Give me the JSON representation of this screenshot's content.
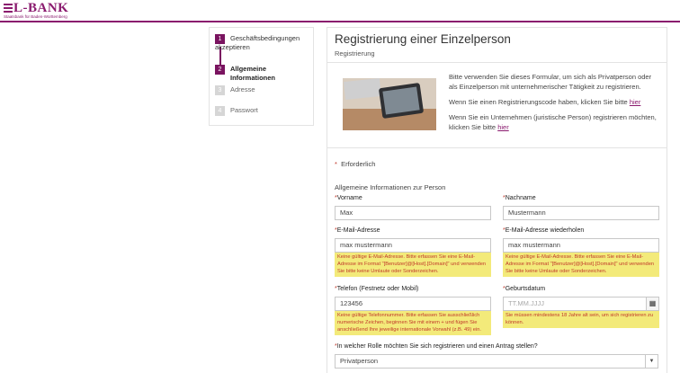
{
  "logo": {
    "name": "L-BANK",
    "subtitle": "Staatsbank für Baden-Württemberg"
  },
  "steps": [
    {
      "num": "1",
      "label": "Geschäftsbedingungen akzeptieren"
    },
    {
      "num": "2",
      "label": "Allgemeine Informationen"
    },
    {
      "num": "3",
      "label": "Adresse"
    },
    {
      "num": "4",
      "label": "Passwort"
    }
  ],
  "main": {
    "title": "Registrierung einer Einzelperson",
    "subtitle": "Registrierung",
    "intro": {
      "p1": "Bitte verwenden Sie dieses Formular, um sich als Privatperson oder als Einzelperson mit unternehmerischer Tätigkeit zu registrieren.",
      "p2_pre": "Wenn Sie einen Registrierungscode haben, klicken Sie bitte ",
      "p3_pre": "Wenn Sie ein Unternehmen (juristische Person) registrieren möchten, klicken Sie bitte ",
      "link": "hier"
    },
    "required_note": "Erforderlich",
    "required_star": "*",
    "group_title": "Allgemeine Informationen zur Person"
  },
  "form": {
    "vorname": {
      "label": "Vorname",
      "value": "Max"
    },
    "nachname": {
      "label": "Nachname",
      "value": "Mustermann"
    },
    "email": {
      "label": "E-Mail-Adresse",
      "value": "max mustermann",
      "error": "Keine gültige E-Mail-Adresse. Bitte erfassen Sie eine E-Mail-Adresse im Format \"[Benutzer]@[Host].[Domain]\" und verwenden Sie bitte keine Umlaute oder Sonderzeichen."
    },
    "email_repeat": {
      "label": "E-Mail-Adresse wiederholen",
      "value": "max mustermann",
      "error": "Keine gültige E-Mail-Adresse. Bitte erfassen Sie eine E-Mail-Adresse im Format \"[Benutzer]@[Host].[Domain]\" und verwenden Sie bitte keine Umlaute oder Sonderzeichen."
    },
    "telefon": {
      "label": "Telefon (Festnetz oder Mobil)",
      "value": "123456",
      "error": "Keine gültige Telefonnummer. Bitte erfassen Sie ausschließlich numerische Zeichen, beginnen Sie mit einem + und fügen Sie anschließend Ihre jeweilige internationale Vorwahl (z.B. 49) ein."
    },
    "geburtsdatum": {
      "label": "Geburtsdatum",
      "placeholder": "TT.MM.JJJJ",
      "error": "Sie müssen mindestens 18 Jahre alt sein, um sich registrieren zu können."
    },
    "rolle": {
      "label": "In welcher Rolle möchten Sie sich registrieren und einen Antrag stellen?",
      "value": "Privatperson"
    }
  },
  "colors": {
    "brand": "#8a1a6e",
    "error_bg": "#f3ea7a",
    "error_text": "#c0392b"
  }
}
